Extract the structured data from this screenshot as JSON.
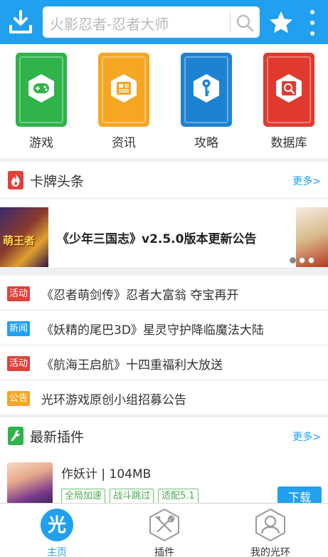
{
  "header": {
    "search_placeholder": "火影忍者-忍者大师"
  },
  "categories": [
    {
      "label": "游戏",
      "color": "#2fb34a",
      "icon": "gamepad-icon"
    },
    {
      "label": "资讯",
      "color": "#f5a623",
      "icon": "newspaper-icon"
    },
    {
      "label": "攻略",
      "color": "#1e82d2",
      "icon": "key-icon"
    },
    {
      "label": "数据库",
      "color": "#e03a2f",
      "icon": "database-search-icon"
    }
  ],
  "headlines": {
    "title": "卡牌头条",
    "more": "更多>",
    "banner_title": "《少年三国志》v2.5.0版本更新公告",
    "banner_left_text": "萌王者"
  },
  "news": [
    {
      "tag": "活动",
      "tag_color": "#e0413a",
      "title": "《忍者萌剑传》忍者大富翁 夺宝再开"
    },
    {
      "tag": "新闻",
      "tag_color": "#21a0f0",
      "title": "《妖精的尾巴3D》星灵守护降临魔法大陆"
    },
    {
      "tag": "活动",
      "tag_color": "#e0413a",
      "title": "《航海王启航》十四重福利大放送"
    },
    {
      "tag": "公告",
      "tag_color": "#f5a623",
      "title": "光环游戏原创小组招募公告"
    }
  ],
  "plugins": {
    "title": "最新插件",
    "more": "更多>",
    "item": {
      "title": "作妖计 | 104MB",
      "tags": [
        "全局加速",
        "战斗跳过",
        "适配5.1"
      ],
      "download": "下载"
    }
  },
  "nav": {
    "home": "主页",
    "home_glyph": "光",
    "plugins": "插件",
    "mine": "我的光环"
  },
  "colors": {
    "accent": "#21a0f0"
  }
}
